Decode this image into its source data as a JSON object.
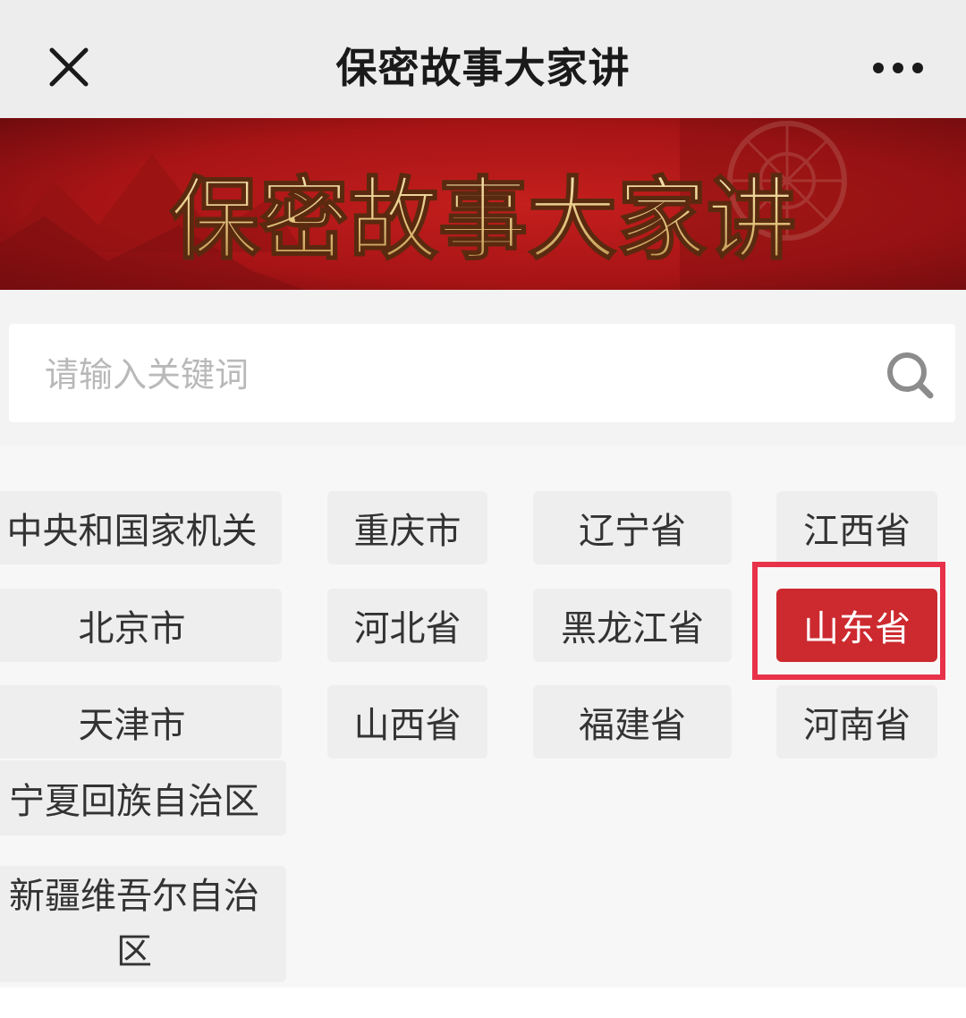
{
  "nav": {
    "title": "保密故事大家讲",
    "close_icon": "close-icon",
    "more_icon": "more-dots-icon"
  },
  "banner": {
    "text": "保密故事大家讲",
    "colors": {
      "background": "#a61416",
      "text": "#e6c98a"
    }
  },
  "search": {
    "placeholder": "请输入关键词",
    "value": "",
    "icon": "search-icon"
  },
  "regions": {
    "items": [
      {
        "label": "中央和国家机关",
        "selected": false
      },
      {
        "label": "重庆市",
        "selected": false
      },
      {
        "label": "辽宁省",
        "selected": false
      },
      {
        "label": "江西省",
        "selected": false
      },
      {
        "label": "北京市",
        "selected": false
      },
      {
        "label": "河北省",
        "selected": false
      },
      {
        "label": "黑龙江省",
        "selected": false
      },
      {
        "label": "山东省",
        "selected": true
      },
      {
        "label": "天津市",
        "selected": false
      },
      {
        "label": "山西省",
        "selected": false
      },
      {
        "label": "福建省",
        "selected": false
      },
      {
        "label": "河南省",
        "selected": false
      },
      {
        "label": "宁夏回族自治区",
        "selected": false
      },
      {
        "label": "新疆维吾尔自治区",
        "selected": false
      }
    ],
    "colors": {
      "selected_bg": "#cc2a2f",
      "highlight_frame": "#e8324a"
    }
  }
}
